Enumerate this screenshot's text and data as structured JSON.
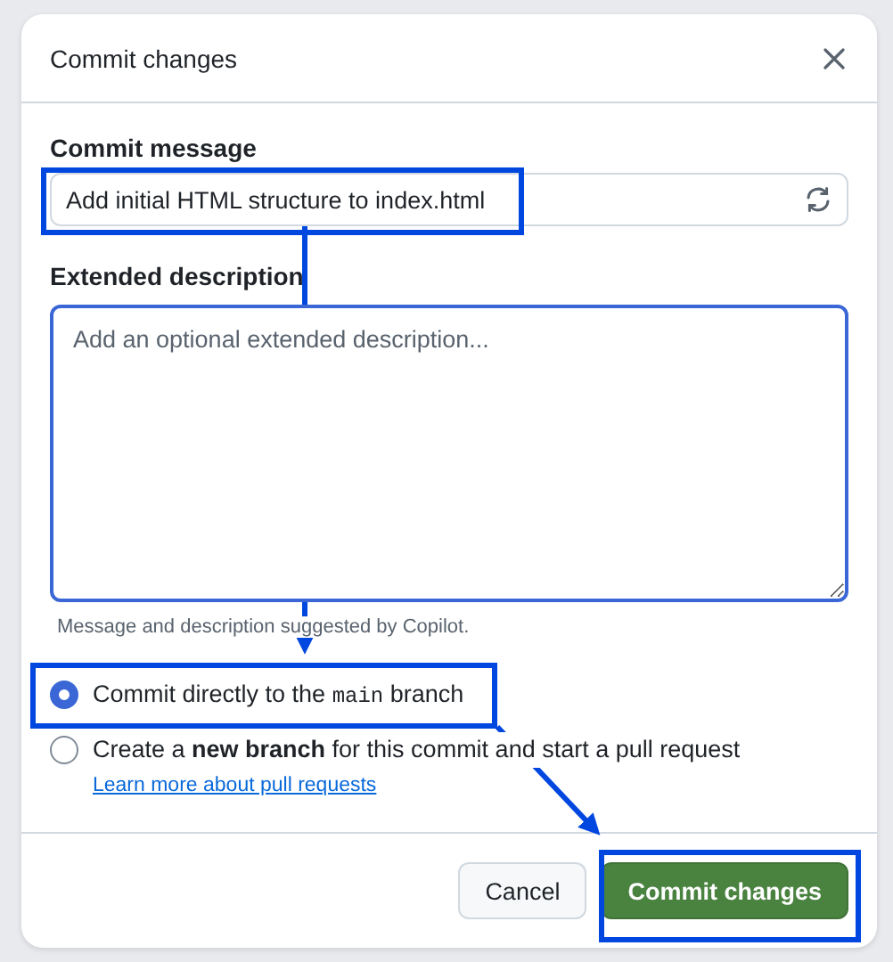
{
  "dialog": {
    "title": "Commit changes"
  },
  "commit_message": {
    "label": "Commit message",
    "value": "Add initial HTML structure to index.html"
  },
  "extended_description": {
    "label": "Extended description",
    "placeholder": "Add an optional extended description..."
  },
  "hint": "Message and description suggested by Copilot.",
  "options": [
    {
      "before": "Commit directly to the",
      "code": "main",
      "after": "branch",
      "selected": true
    },
    {
      "text": "Create a **new branch** for this commit and start a pull request",
      "link": "Learn more about pull requests",
      "selected": false
    }
  ],
  "buttons": [
    {
      "label": "Cancel",
      "kind": "secondary"
    },
    {
      "label": "Commit changes",
      "kind": "primary"
    }
  ]
}
